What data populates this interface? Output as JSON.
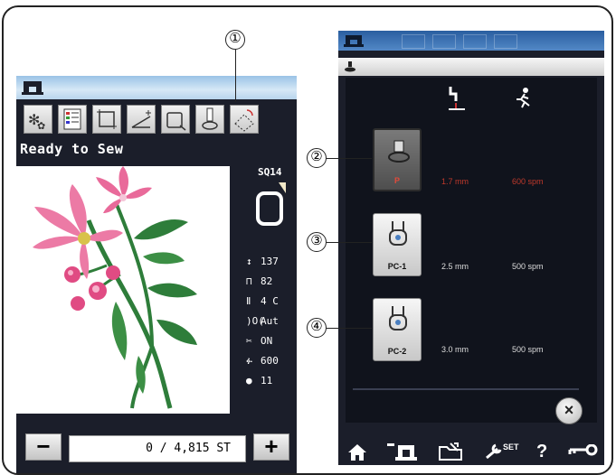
{
  "left_screen": {
    "status_title": "Ready to Sew",
    "pattern_size": "SQ14",
    "stats": [
      {
        "icon": "height-icon",
        "glyph": "↕",
        "value": "137"
      },
      {
        "icon": "width-icon",
        "glyph": "⊓",
        "value": "82"
      },
      {
        "icon": "thread-spool-icon",
        "glyph": "Ⅱ",
        "value": "4 C"
      },
      {
        "icon": "tension-icon",
        "glyph": ")O(",
        "value": "Aut"
      },
      {
        "icon": "scissors-icon",
        "glyph": "✂",
        "value": "ON"
      },
      {
        "icon": "speed-runner-icon",
        "glyph": "ፉ",
        "value": "600"
      },
      {
        "icon": "clock-icon",
        "glyph": "●",
        "value": "11"
      }
    ],
    "minus_label": "−",
    "plus_label": "+",
    "stitch_counter": "0 / 4,815 ST"
  },
  "right_screen": {
    "feet": [
      {
        "label": "P",
        "height": "1.7 mm",
        "speed": "600 spm",
        "selected": true
      },
      {
        "label": "PC-1",
        "height": "2.5 mm",
        "speed": "500 spm",
        "selected": false
      },
      {
        "label": "PC-2",
        "height": "3.0 mm",
        "speed": "500 spm",
        "selected": false
      }
    ],
    "close_label": "×",
    "nav_set_label": "SET",
    "nav_help_label": "?"
  },
  "callouts": [
    "①",
    "②",
    "③",
    "④"
  ],
  "colors": {
    "screen_dark": "#1b1e2a",
    "selected_text": "#c0392b",
    "accent_blue": "#4a7fc0",
    "flower_pink": "#e96a9a",
    "leaf_green": "#2e7d3a"
  }
}
